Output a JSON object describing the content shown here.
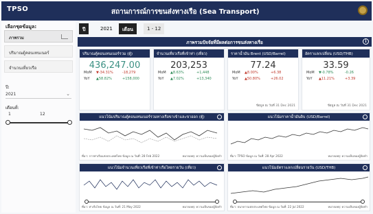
{
  "header": {
    "logo": "TPSO",
    "title": "สถานการณ์การขนส่งทางเรือ (Sea Transport)"
  },
  "sidebar": {
    "section_title": "เลือกชุดข้อมูล:",
    "items": [
      {
        "label": "ภาพรวม",
        "active": true
      },
      {
        "label": "ปริมาณตู้คอนเทนเนอร์",
        "active": false
      },
      {
        "label": "จำนวนเที่ยวเรือ",
        "active": false
      }
    ],
    "year_label": "ปี:",
    "year_value": "2021",
    "month_label": "เดือนที่:",
    "month_from": "1",
    "month_to": "12"
  },
  "toolbar": {
    "year_tag": "ปี",
    "year_value": "2021",
    "month_tag": "เดือน",
    "month_value": "1 - 12"
  },
  "banner": {
    "title": "ภาพรวมปัจจัยที่มีผลต่อการขนส่งทางเรือ"
  },
  "kpis": [
    {
      "title": "ปริมาณตู้คอนเทนเนอร์รวม (ตู้)",
      "value": "436,247.00",
      "mom_label": "MoM",
      "mom_pct": "▼-34.31%",
      "mom_abs": "-18,279",
      "yoy_label": "YoY",
      "yoy_pct": "▲58.82%",
      "yoy_abs": "+158,000",
      "foot": ""
    },
    {
      "title": "จำนวนเที่ยวเรือที่เข้าท่า (เที่ยว)",
      "value": "203,253",
      "mom_label": "MoM",
      "mom_pct": "▲8.63%",
      "mom_abs": "+1,448",
      "yoy_label": "YoY",
      "yoy_pct": "▲7.02%",
      "yoy_abs": "+13,340",
      "foot": ""
    },
    {
      "title": "ราคาน้ำมัน Brent (USD/Barrel)",
      "value": "77.24",
      "mom_label": "MoM",
      "mom_pct": "▲8.00%",
      "mom_abs": "+6.38",
      "yoy_label": "YoY",
      "yoy_pct": "▲50.80%",
      "yoy_abs": "+26.02",
      "foot": "ข้อมูล ณ วันที่ 31 Dec 2021"
    },
    {
      "title": "อัตราแลกเปลี่ยน (USD/THB)",
      "value": "33.59",
      "mom_label": "MoM",
      "mom_pct": "▼-0.78%",
      "mom_abs": "-0.26",
      "yoy_label": "YoY",
      "yoy_pct": "▲11.21%",
      "yoy_abs": "+3.39",
      "foot": "ข้อมูล ณ วันที่ 31 Dec 2021"
    }
  ],
  "charts": [
    {
      "title": "แนวโน้มปริมาณตู้คอนเทนเนอร์รวมทางเรือขาเข้าและขาออก (ตู้)",
      "source": "ที่มา: การท่าเรือแห่งประเทศไทย  ข้อมูล ณ วันที่: 28 Feb 2022",
      "note": "หมายเหตุ: ความเห็นของผู้จัดทำ"
    },
    {
      "title": "แนวโน้มราคาน้ำมันดิบ (USD/Barrel)",
      "source": "ที่มา: TPSO  ข้อมูล ณ วันที่: 28 Apr 2022",
      "note": "หมายเหตุ: ความเห็นของผู้จัดทำ"
    },
    {
      "title": "แนวโน้มจำนวนเที่ยวเรือที่เข้าท่าเรือไทยรายวัน (เที่ยว)",
      "source": "ที่มา: ท่าเรือไทย  ข้อมูล ณ วันที่: 21 May 2022",
      "note": "หมายเหตุ: ความเห็นของผู้จัดทำ"
    },
    {
      "title": "แนวโน้มอัตราแลกเปลี่ยนรายวัน (USD/THB)",
      "source": "ที่มา: ธนาคารแห่งประเทศไทย  ข้อมูล ณ วันที่: 22 Jul 2022",
      "note": "หมายเหตุ: ความเห็นของผู้จัดทำ"
    }
  ],
  "colors": {
    "navy": "#1f2f5a",
    "teal": "#3a8f82",
    "neg": "#c0392b",
    "pos": "#2e8b57"
  }
}
